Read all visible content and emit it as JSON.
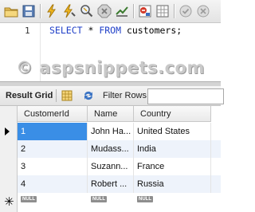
{
  "toolbar": {
    "icons": [
      "open-folder-icon",
      "save-icon",
      "execute-icon",
      "execute-current-icon",
      "explain-icon",
      "stop-icon",
      "toggle-result-icon",
      "toggle-output-icon",
      "autocommit-icon",
      "commit-icon"
    ]
  },
  "editor": {
    "line_number": "1",
    "keyword_select": "SELECT",
    "star": " * ",
    "keyword_from": "FROM",
    "table": " customers;",
    "watermark": "© aspsnippets.com"
  },
  "gridbar": {
    "tab_label": "Result Grid",
    "filter_label": "Filter Rows:",
    "filter_value": ""
  },
  "grid": {
    "columns": [
      "CustomerId",
      "Name",
      "Country"
    ],
    "rows": [
      {
        "id": "1",
        "name": "John Ha...",
        "country": "United States"
      },
      {
        "id": "2",
        "name": "Mudass...",
        "country": "India"
      },
      {
        "id": "3",
        "name": "Suzann...",
        "country": "France"
      },
      {
        "id": "4",
        "name": "Robert ...",
        "country": "Russia"
      }
    ],
    "null_label": "NULL"
  },
  "colors": {
    "keyword": "#2040c8",
    "selection": "#3a8ee6",
    "alt_row": "#eef3fb"
  }
}
